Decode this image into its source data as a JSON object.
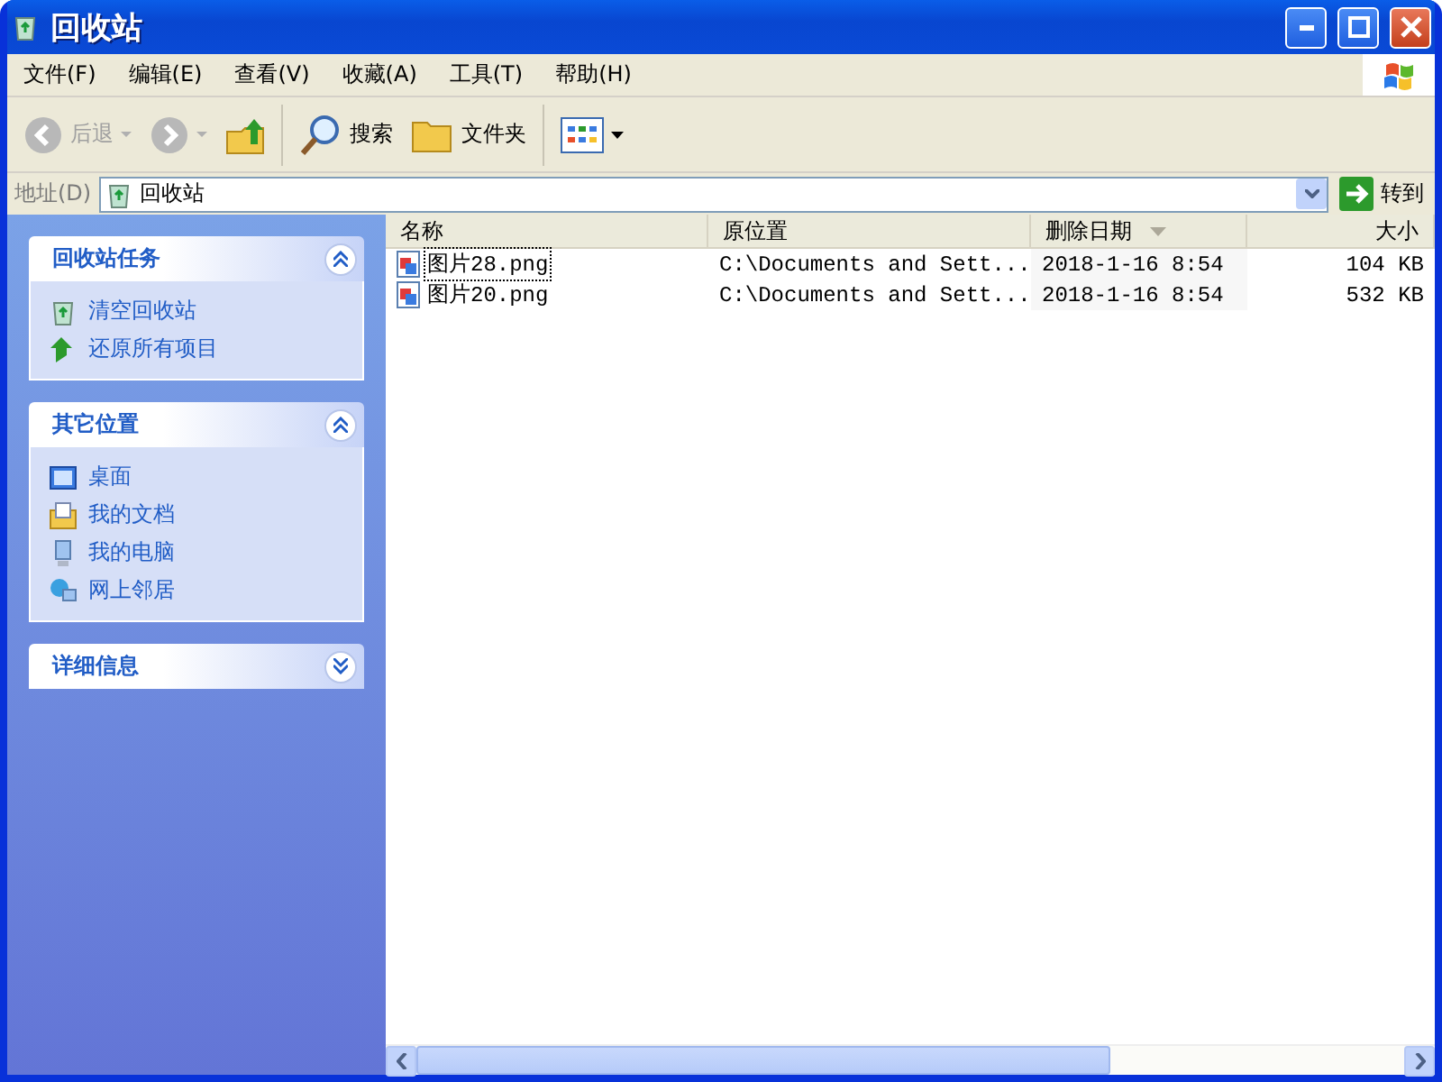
{
  "window": {
    "title": "回收站"
  },
  "menu": [
    "文件(F)",
    "编辑(E)",
    "查看(V)",
    "收藏(A)",
    "工具(T)",
    "帮助(H)"
  ],
  "toolbar": {
    "back": {
      "label": "后退",
      "disabled": true
    },
    "forward": {
      "disabled": true
    },
    "search": "搜索",
    "folders": "文件夹"
  },
  "address": {
    "label": "地址(D)",
    "value": "回收站",
    "go": "转到"
  },
  "sidebar": [
    {
      "title": "回收站任务",
      "expanded": true,
      "items": [
        {
          "label": "清空回收站",
          "kind": "bin"
        },
        {
          "label": "还原所有项目",
          "kind": "restore"
        }
      ]
    },
    {
      "title": "其它位置",
      "expanded": true,
      "items": [
        {
          "label": "桌面",
          "kind": "desktop"
        },
        {
          "label": "我的文档",
          "kind": "documents"
        },
        {
          "label": "我的电脑",
          "kind": "computer"
        },
        {
          "label": "网上邻居",
          "kind": "network"
        }
      ]
    },
    {
      "title": "详细信息",
      "expanded": false
    }
  ],
  "table": {
    "columns": [
      {
        "label": "名称",
        "sorted": false
      },
      {
        "label": "原位置",
        "sorted": false
      },
      {
        "label": "删除日期",
        "sorted": true
      },
      {
        "label": "大小",
        "sorted": false
      }
    ],
    "rows": [
      {
        "name": "图片28.png",
        "location": "C:\\Documents and Sett...",
        "date": "2018-1-16 8:54",
        "size": "104 KB",
        "focused": true
      },
      {
        "name": "图片20.png",
        "location": "C:\\Documents and Sett...",
        "date": "2018-1-16 8:54",
        "size": "532 KB",
        "focused": false
      }
    ]
  }
}
